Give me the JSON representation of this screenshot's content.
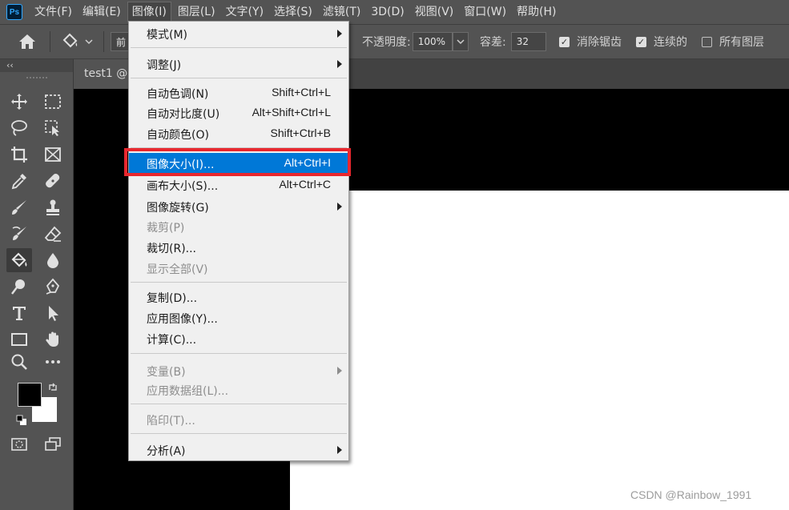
{
  "app": {
    "logo": "Ps"
  },
  "menubar": {
    "items": [
      "文件(F)",
      "编辑(E)",
      "图像(I)",
      "图层(L)",
      "文字(Y)",
      "选择(S)",
      "滤镜(T)",
      "3D(D)",
      "视图(V)",
      "窗口(W)",
      "帮助(H)"
    ],
    "active_item": "图像(I)"
  },
  "options_bar": {
    "fill_source_partial": "前",
    "opacity_label": "不透明度:",
    "opacity_value": "100%",
    "tolerance_label": "容差:",
    "tolerance_value": "32",
    "antialias_label": "消除锯齿",
    "antialias_checked": true,
    "contiguous_label": "连续的",
    "contiguous_checked": true,
    "all_layers_label": "所有图层",
    "all_layers_checked": false
  },
  "toolbar": {
    "collapse": "‹‹",
    "tools": [
      "move-icon",
      "marquee-icon",
      "lasso-icon",
      "object-select-icon",
      "crop-icon",
      "frame-icon",
      "eyedropper-icon",
      "healing-icon",
      "brush-icon",
      "stamp-icon",
      "history-brush-icon",
      "eraser-icon",
      "paint-bucket-icon",
      "blur-icon",
      "dodge-icon",
      "pen-icon",
      "type-icon",
      "path-select-icon",
      "rectangle-icon",
      "hand-icon",
      "zoom-icon",
      "more-icon"
    ],
    "selected_tool": "paint-bucket-icon",
    "foreground_color": "#000000",
    "background_color": "#ffffff"
  },
  "document": {
    "tab_label": "test1 @"
  },
  "image_menu": {
    "items": [
      {
        "label": "模式(M)",
        "shortcut": "",
        "submenu": true,
        "enabled": true
      },
      {
        "label": "调整(J)",
        "shortcut": "",
        "submenu": true,
        "enabled": true
      },
      {
        "label": "自动色调(N)",
        "shortcut": "Shift+Ctrl+L",
        "submenu": false,
        "enabled": true
      },
      {
        "label": "自动对比度(U)",
        "shortcut": "Alt+Shift+Ctrl+L",
        "submenu": false,
        "enabled": true
      },
      {
        "label": "自动颜色(O)",
        "shortcut": "Shift+Ctrl+B",
        "submenu": false,
        "enabled": true
      },
      {
        "label": "图像大小(I)...",
        "shortcut": "Alt+Ctrl+I",
        "submenu": false,
        "enabled": true,
        "highlighted": true
      },
      {
        "label": "画布大小(S)...",
        "shortcut": "Alt+Ctrl+C",
        "submenu": false,
        "enabled": true
      },
      {
        "label": "图像旋转(G)",
        "shortcut": "",
        "submenu": true,
        "enabled": true
      },
      {
        "label": "裁剪(P)",
        "shortcut": "",
        "submenu": false,
        "enabled": false
      },
      {
        "label": "裁切(R)...",
        "shortcut": "",
        "submenu": false,
        "enabled": true
      },
      {
        "label": "显示全部(V)",
        "shortcut": "",
        "submenu": false,
        "enabled": false
      },
      {
        "label": "复制(D)...",
        "shortcut": "",
        "submenu": false,
        "enabled": true
      },
      {
        "label": "应用图像(Y)...",
        "shortcut": "",
        "submenu": false,
        "enabled": true
      },
      {
        "label": "计算(C)...",
        "shortcut": "",
        "submenu": false,
        "enabled": true
      },
      {
        "label": "变量(B)",
        "shortcut": "",
        "submenu": true,
        "enabled": false
      },
      {
        "label": "应用数据组(L)...",
        "shortcut": "",
        "submenu": false,
        "enabled": false
      },
      {
        "label": "陷印(T)...",
        "shortcut": "",
        "submenu": false,
        "enabled": false
      },
      {
        "label": "分析(A)",
        "shortcut": "",
        "submenu": true,
        "enabled": true
      }
    ]
  },
  "colors": {
    "highlight": "#0078d7",
    "annotation_box": "#e8272e"
  },
  "watermark": "CSDN @Rainbow_1991"
}
